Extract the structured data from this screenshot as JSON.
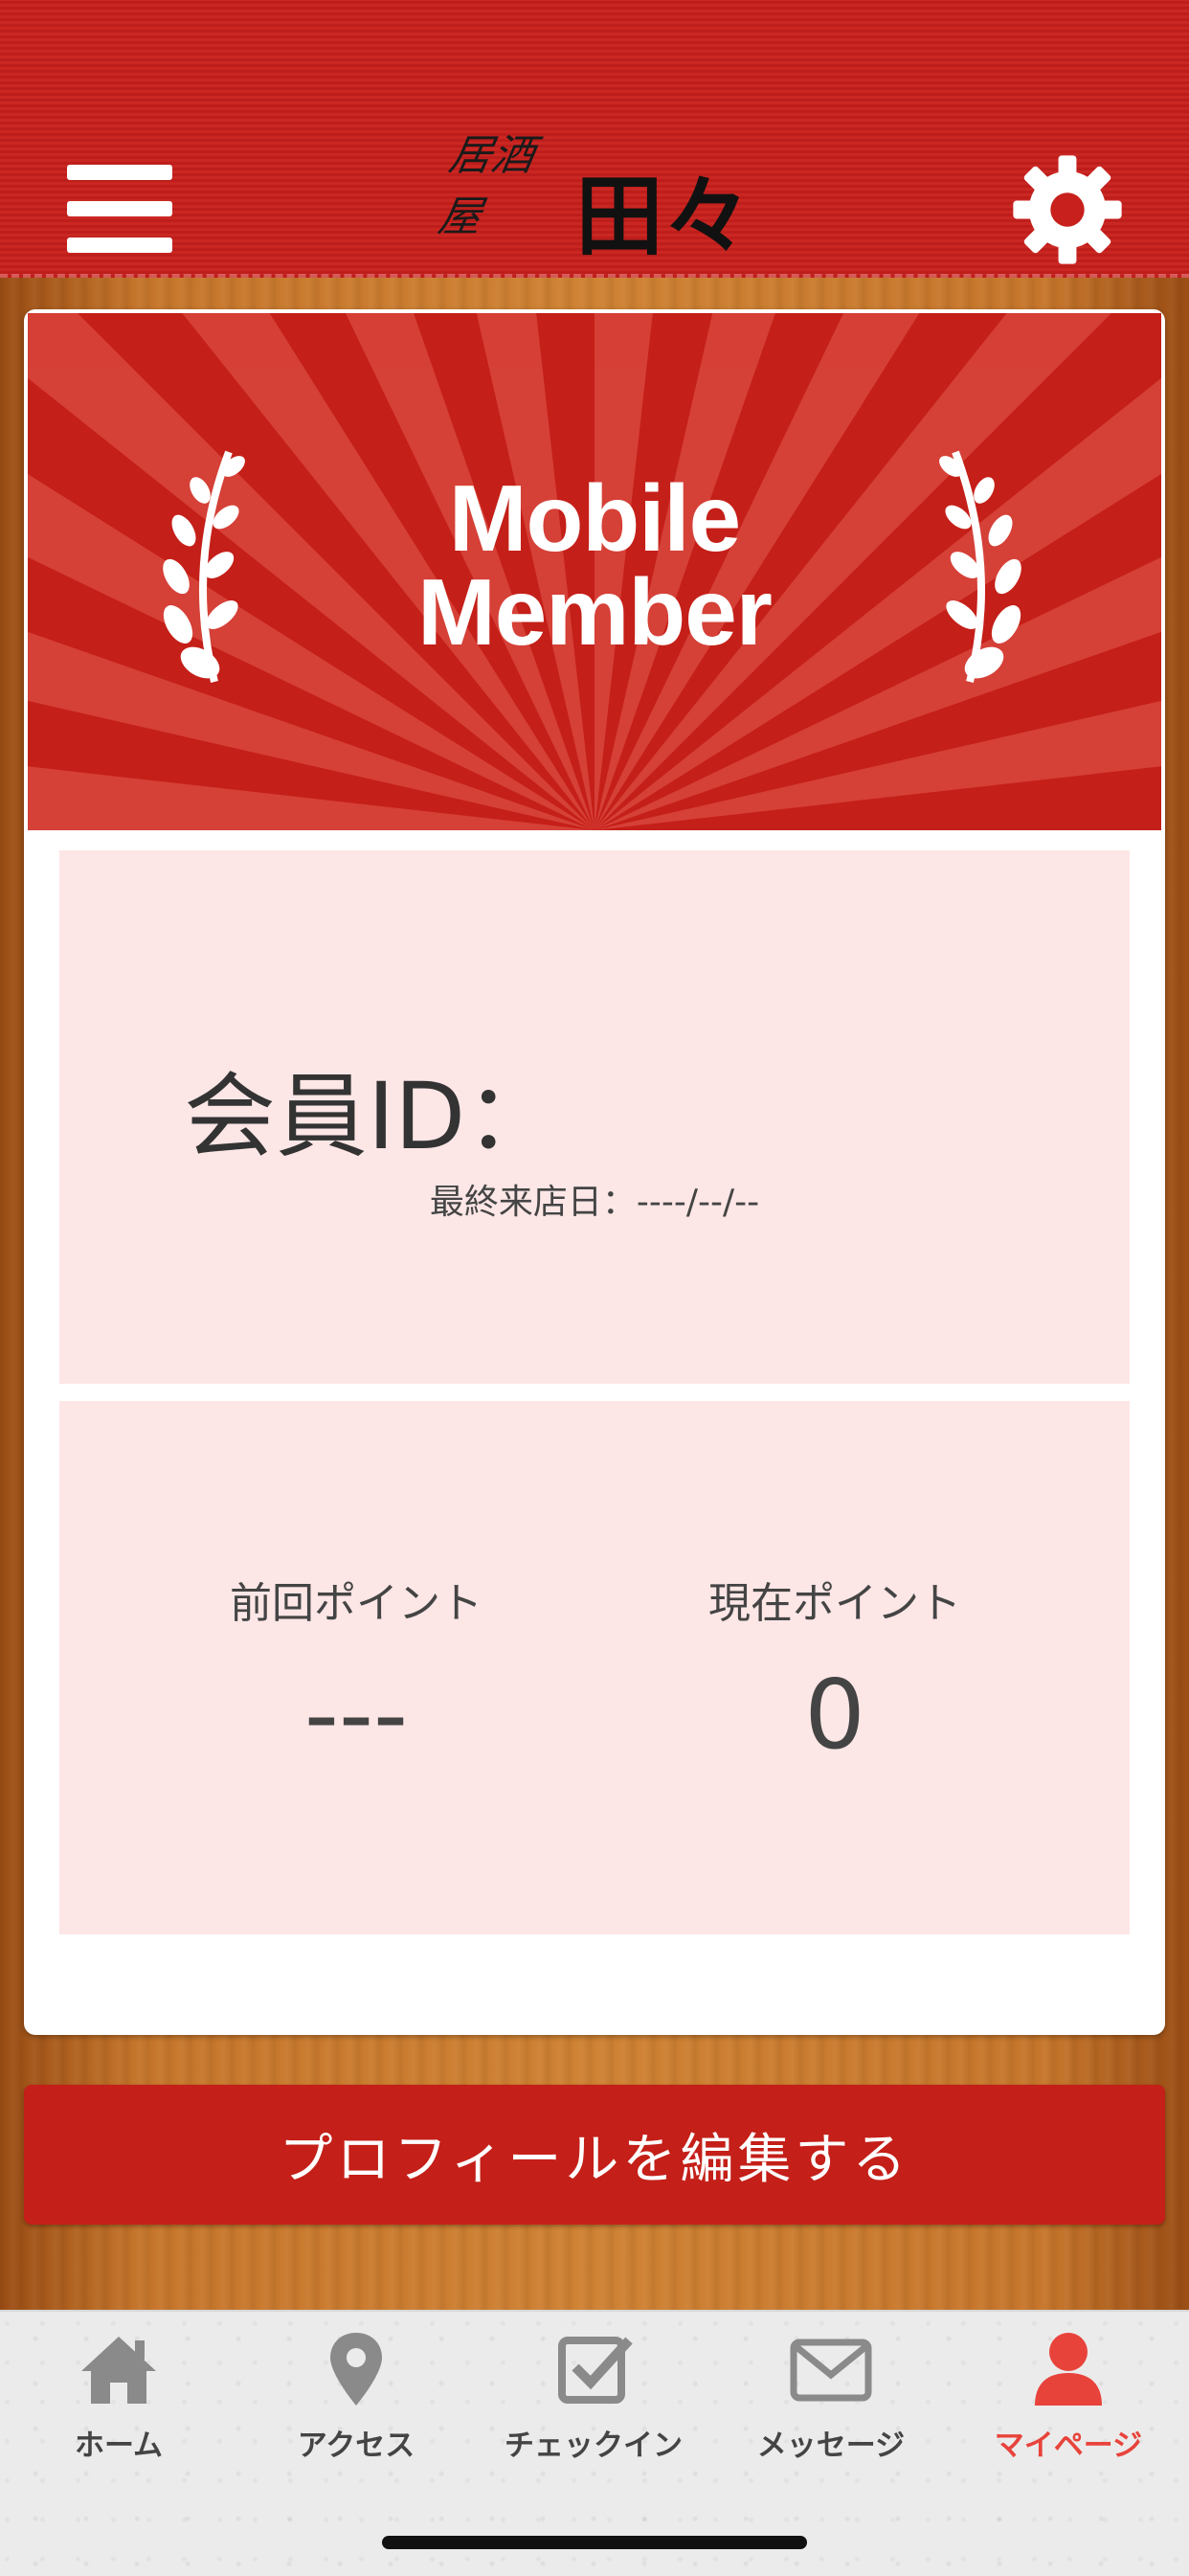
{
  "header": {
    "logo_small": "居酒屋",
    "logo_big": "田々",
    "menu_icon": "hamburger-menu-icon",
    "settings_icon": "gear-icon",
    "color": "#c8201c"
  },
  "banner": {
    "title_line1": "Mobile",
    "title_line2": "Member",
    "color": "#c41f18"
  },
  "member": {
    "id_label": "会員ID：",
    "last_visit": "最終来店日：----/--/--"
  },
  "points": {
    "previous_label": "前回ポイント",
    "previous_value": "---",
    "current_label": "現在ポイント",
    "current_value": "0"
  },
  "edit_button": "プロフィールを編集する",
  "tabs": [
    {
      "label": "ホーム",
      "icon": "home-icon",
      "active": false
    },
    {
      "label": "アクセス",
      "icon": "map-pin-icon",
      "active": false
    },
    {
      "label": "チェックイン",
      "icon": "checkbox-icon",
      "active": false
    },
    {
      "label": "メッセージ",
      "icon": "envelope-icon",
      "active": false
    },
    {
      "label": "マイページ",
      "icon": "user-icon",
      "active": true
    }
  ],
  "accent_color": "#e8433b"
}
